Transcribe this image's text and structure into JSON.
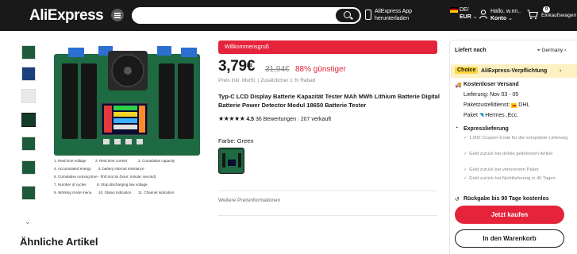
{
  "header": {
    "logo": "AliExpress",
    "app_line1": "AliExpress App",
    "app_line2": "herunterladen",
    "lang_line1": "DE/",
    "lang_line2": "EUR",
    "user_line1": "Hallo, w.nn..",
    "user_line2": "Konto",
    "cart_count": "0",
    "cart_label": "Einkaufswagen",
    "search_placeholder": ""
  },
  "features": [
    "1. Real time voltage",
    "2. Real time current",
    "3. Cumulative capacity",
    "4. Accumulated energy",
    "5. battery internal resistance",
    "6. Cumulative running time - hhh:mm:ss (hour: minute: second)",
    "7. Number of cycles",
    "8. Stop discharging low voltage",
    "9. Working mode menu",
    "10. Status indication",
    "11. Channel indication"
  ],
  "product": {
    "welcome": "Willkommensgruß",
    "price": "3,79€",
    "old_price": "31,94€",
    "discount": "88% günstiger",
    "tax_note": "Preis inkl. MwSt. | Zusätzlicher 1 % Rabatt",
    "title": "Typ-C LCD Display Batterie Kapazität Tester MAh MWh Lithium Batterie Digital Batterie Power Detector Modul 18650 Batterie Tester",
    "stars": "★★★★★",
    "rating": "4.5",
    "reviews": "36 Bewertungen",
    "sold": "207 verkauft",
    "color_label": "Farbe: Green",
    "more_prices": "Weitere Preisinformationen",
    "similar": "Ähnliche Artikel"
  },
  "panel": {
    "ship_to": "Liefert nach",
    "location": "Germany",
    "choice_tag": "Choice",
    "choice_text": "AliExpress-Verpflichtung",
    "free_ship": "Kostenloser Versand",
    "delivery": "Lieferung: Nov 03 - 05",
    "carrier1": "Paketzustelldienst:",
    "carrier1b": "DHL",
    "carrier2": "Paket",
    "carrier2b": "Hermes ,Ecc.",
    "express": "Expresslieferung",
    "c1": "1,00€ Coupon-Code für die verspätete Lieferung",
    "c2": "Geld zurück bei defekt geliefertem Artikel",
    "c3": "Geld zurück bei verlorenem Paket",
    "c4": "Geld zurück bei Nichtlieferung in 40 Tagen",
    "returns": "Rückgabe bis 90 Tage kostenlos",
    "buy_now": "Jetzt kaufen",
    "add_cart": "In den Warenkorb"
  },
  "colors": {
    "brand_red": "#e5243b",
    "header_bg": "#191919",
    "choice_yellow": "#ffd63f",
    "pcb_green": "#1d5a3a"
  }
}
